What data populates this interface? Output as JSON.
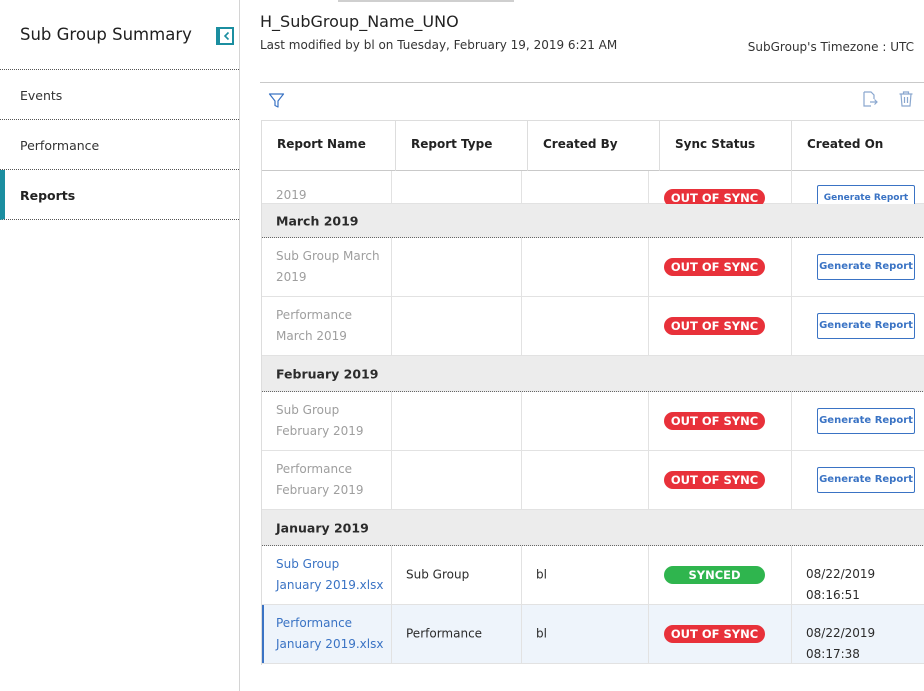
{
  "sidebar": {
    "title": "Sub Group Summary",
    "items": [
      {
        "label": "Events"
      },
      {
        "label": "Performance"
      },
      {
        "label": "Reports"
      }
    ]
  },
  "header": {
    "title": "H_SubGroup_Name_UNO",
    "subtitle": "Last modified by bl on Tuesday, February 19, 2019 6:21 AM",
    "timezone": "SubGroup's Timezone : UTC"
  },
  "toolbar": {
    "filter_icon": "filter-icon",
    "export_icon": "export-icon",
    "delete_icon": "trash-icon"
  },
  "table": {
    "columns": [
      "Report Name",
      "Report Type",
      "Created By",
      "Sync Status",
      "Created On"
    ],
    "partial_row": {
      "name": "2019",
      "status": "OUT OF SYNC",
      "action": "Generate Report"
    },
    "groups": [
      {
        "label": "March 2019",
        "rows": [
          {
            "name": "Sub Group March 2019",
            "type": "",
            "by": "",
            "status": "OUT OF SYNC",
            "action": "Generate Report"
          },
          {
            "name": "Performance March 2019",
            "type": "",
            "by": "",
            "status": "OUT OF SYNC",
            "action": "Generate Report"
          }
        ]
      },
      {
        "label": "February 2019",
        "rows": [
          {
            "name": "Sub Group February 2019",
            "type": "",
            "by": "",
            "status": "OUT OF SYNC",
            "action": "Generate Report"
          },
          {
            "name": "Performance February 2019",
            "type": "",
            "by": "",
            "status": "OUT OF SYNC",
            "action": "Generate Report"
          }
        ]
      },
      {
        "label": "January 2019",
        "rows": [
          {
            "name": "Sub Group January 2019.xlsx",
            "type": "Sub Group",
            "by": "bl",
            "status": "SYNCED",
            "date": "08/22/2019",
            "time": "08:16:51"
          },
          {
            "name": "Performance January 2019.xlsx",
            "type": "Performance",
            "by": "bl",
            "status": "OUT OF SYNC",
            "date": "08/22/2019",
            "time": "08:17:38"
          }
        ]
      }
    ]
  },
  "colors": {
    "accent": "#1b8ea0",
    "link": "#3a73c4",
    "out_of_sync": "#e8313a",
    "synced": "#2fb54e"
  }
}
